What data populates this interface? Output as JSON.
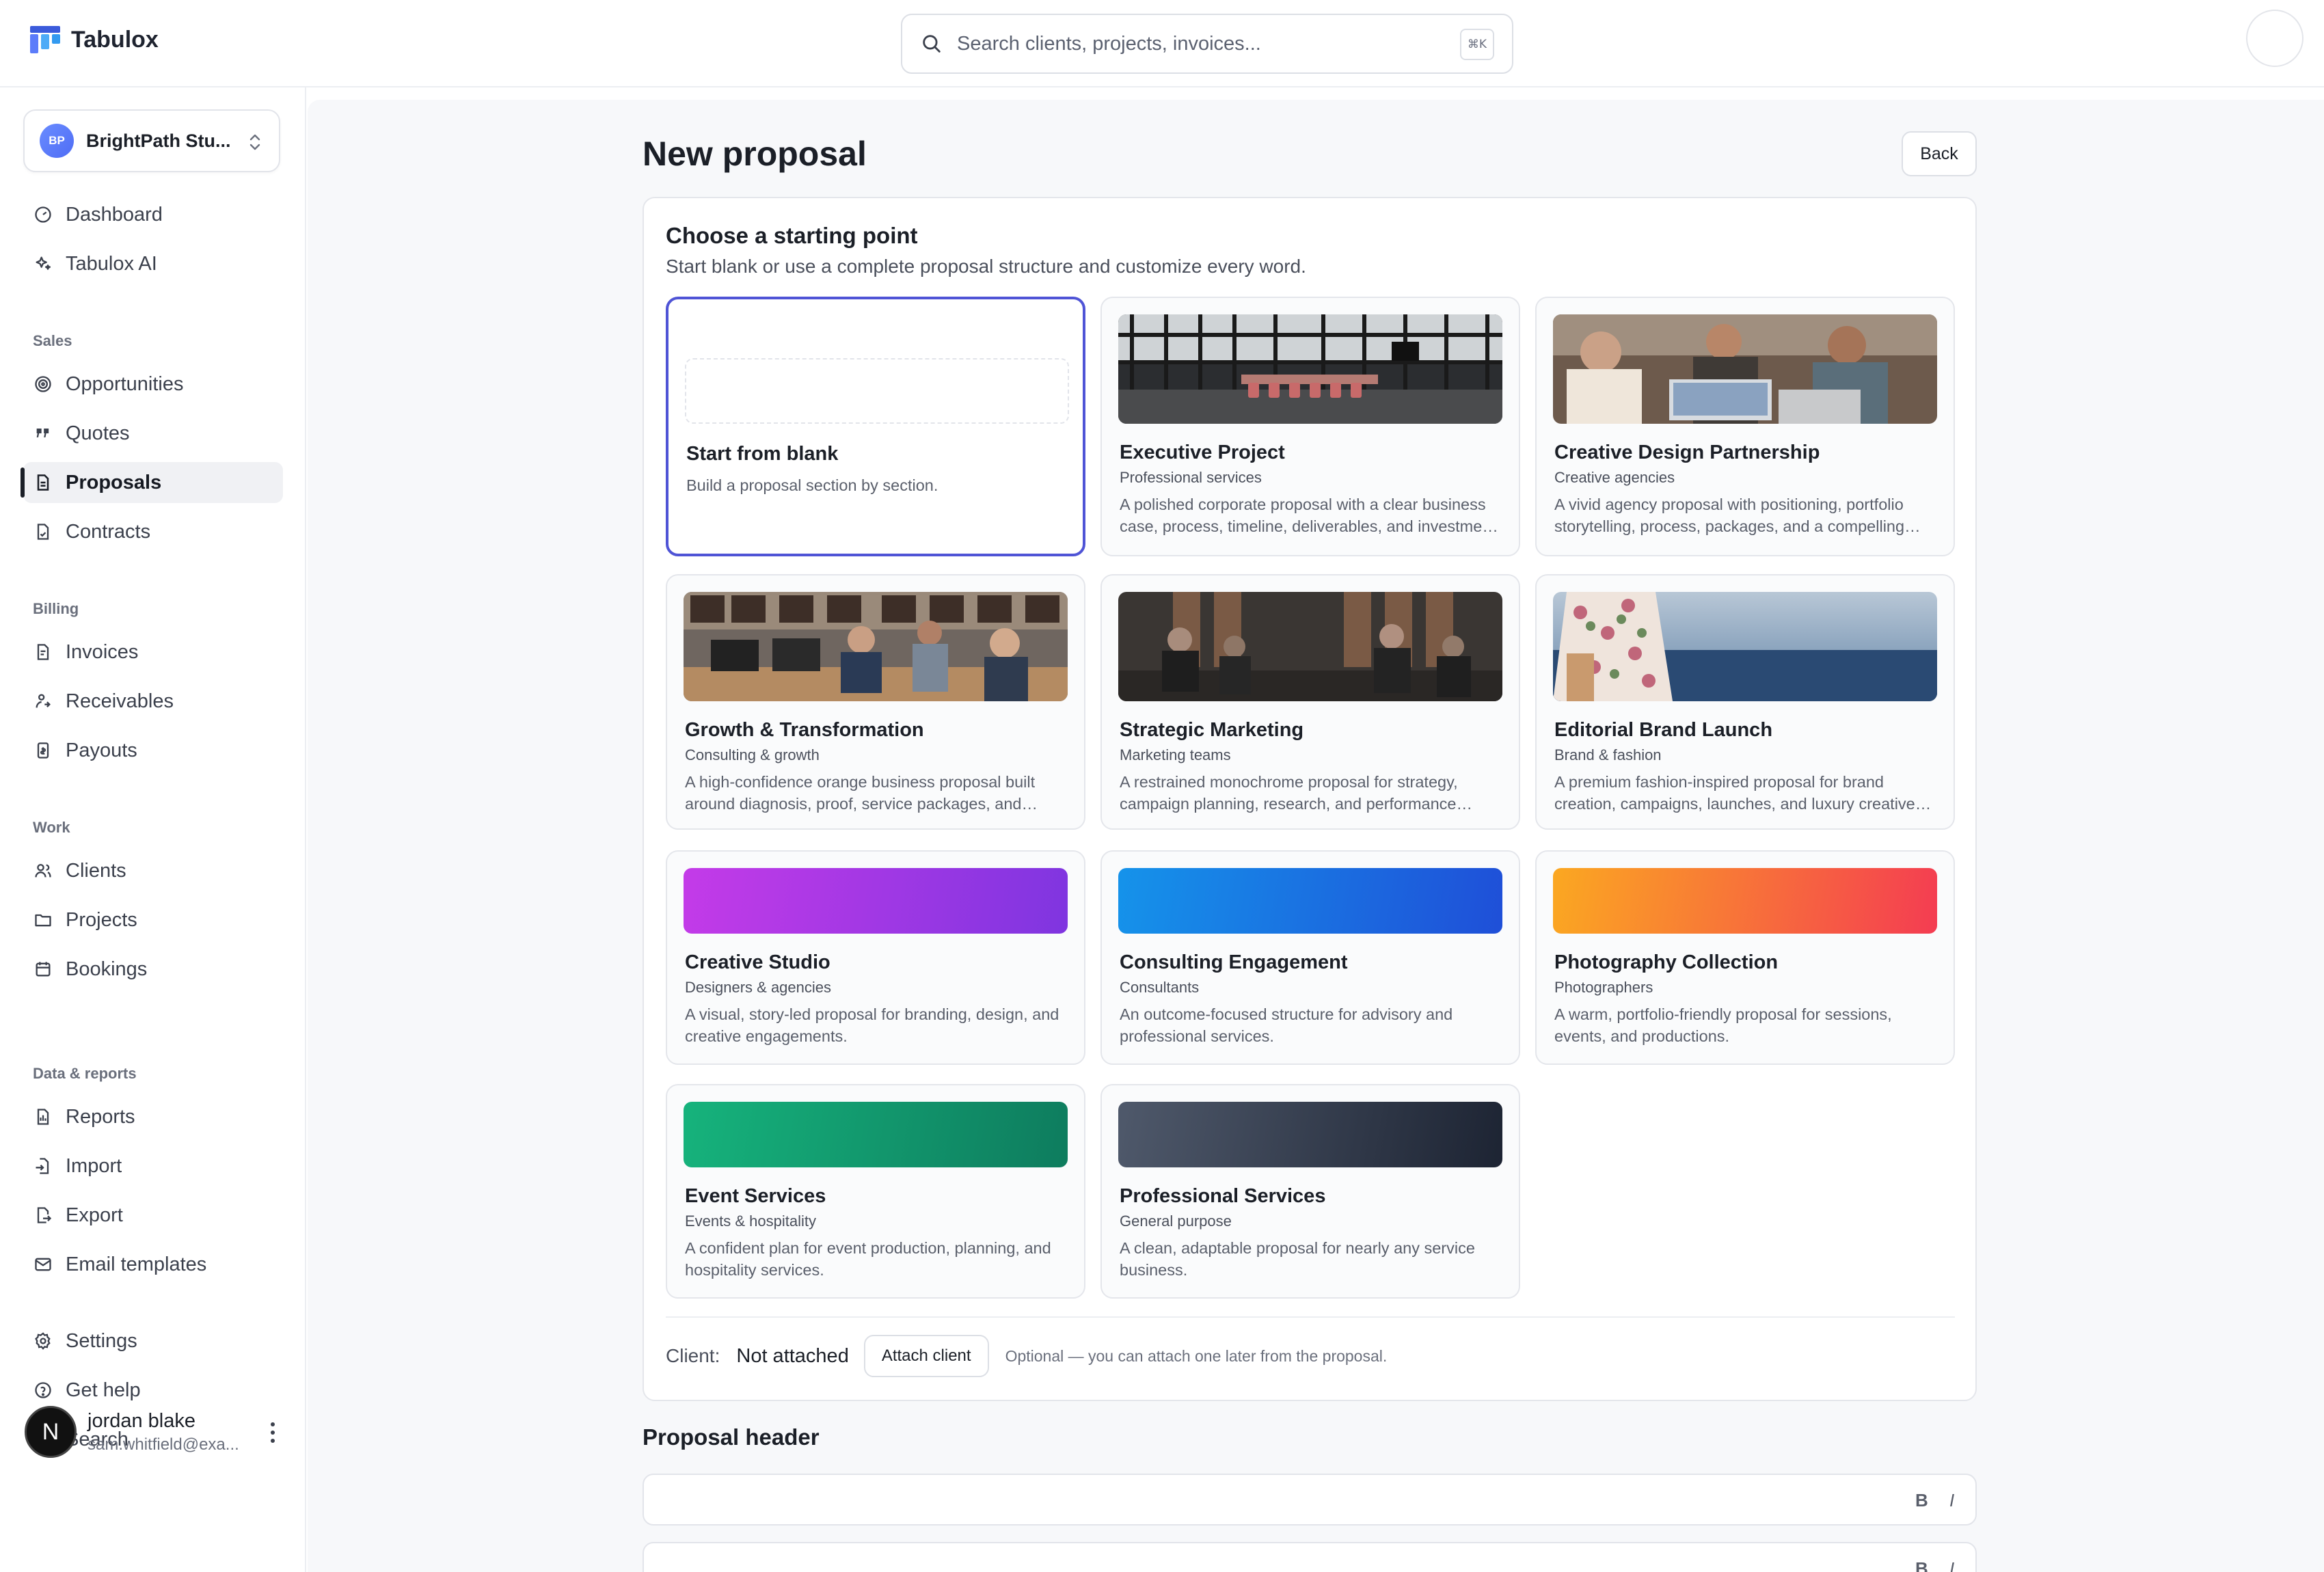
{
  "app": {
    "name": "Tabulox"
  },
  "search": {
    "placeholder": "Search clients, projects, invoices...",
    "shortcut": "⌘K"
  },
  "workspace": {
    "initials": "BP",
    "name": "BrightPath Stu..."
  },
  "sidebar": {
    "top_items": [
      {
        "label": "Dashboard",
        "icon": "gauge-icon"
      },
      {
        "label": "Tabulox AI",
        "icon": "sparkles-icon"
      }
    ],
    "sections": [
      {
        "title": "Sales",
        "items": [
          {
            "label": "Opportunities",
            "icon": "target-icon"
          },
          {
            "label": "Quotes",
            "icon": "quote-icon"
          },
          {
            "label": "Proposals",
            "icon": "document-icon",
            "active": true
          },
          {
            "label": "Contracts",
            "icon": "contract-icon"
          }
        ]
      },
      {
        "title": "Billing",
        "items": [
          {
            "label": "Invoices",
            "icon": "invoice-icon"
          },
          {
            "label": "Receivables",
            "icon": "receivables-icon"
          },
          {
            "label": "Payouts",
            "icon": "payouts-icon"
          }
        ]
      },
      {
        "title": "Work",
        "items": [
          {
            "label": "Clients",
            "icon": "users-icon"
          },
          {
            "label": "Projects",
            "icon": "folder-icon"
          },
          {
            "label": "Bookings",
            "icon": "calendar-icon"
          }
        ]
      },
      {
        "title": "Data & reports",
        "items": [
          {
            "label": "Reports",
            "icon": "reports-icon"
          },
          {
            "label": "Import",
            "icon": "import-icon"
          },
          {
            "label": "Export",
            "icon": "export-icon"
          },
          {
            "label": "Email templates",
            "icon": "mail-icon"
          }
        ]
      }
    ],
    "bottom_items": [
      {
        "label": "Settings",
        "icon": "gear-icon"
      },
      {
        "label": "Get help",
        "icon": "help-icon"
      },
      {
        "label": "Search",
        "icon": "search-icon"
      }
    ],
    "user": {
      "initial": "N",
      "name": "jordan blake",
      "email": "sam.whitfield@exa..."
    }
  },
  "page": {
    "title": "New proposal",
    "back_label": "Back",
    "chooser": {
      "title": "Choose a starting point",
      "subtitle": "Start blank or use a complete proposal structure and customize every word."
    },
    "templates": [
      {
        "name": "Start from blank",
        "category": "",
        "description": "Build a proposal section by section.",
        "kind": "blank",
        "selected": true
      },
      {
        "name": "Executive Project",
        "category": "Professional services",
        "description": "A polished corporate proposal with a clear business case, process, timeline, deliverables, and investment summary.",
        "kind": "photo",
        "scene": "office-interior"
      },
      {
        "name": "Creative Design Partnership",
        "category": "Creative agencies",
        "description": "A vivid agency proposal with positioning, portfolio storytelling, process, packages, and a compelling close.",
        "kind": "photo",
        "scene": "team-laptop"
      },
      {
        "name": "Growth & Transformation",
        "category": "Consulting & growth",
        "description": "A high-confidence orange business proposal built around diagnosis, proof, service packages, and outcomes.",
        "kind": "photo",
        "scene": "open-office"
      },
      {
        "name": "Strategic Marketing",
        "category": "Marketing teams",
        "description": "A restrained monochrome proposal for strategy, campaign planning, research, and performance reporting.",
        "kind": "photo",
        "scene": "meeting-mono"
      },
      {
        "name": "Editorial Brand Launch",
        "category": "Brand & fashion",
        "description": "A premium fashion-inspired proposal for brand creation, campaigns, launches, and luxury creative direction.",
        "kind": "photo",
        "scene": "fashion-sea"
      },
      {
        "name": "Creative Studio",
        "category": "Designers & agencies",
        "description": "A visual, story-led proposal for branding, design, and creative engagements.",
        "kind": "gradient",
        "colors": [
          "#c43be8",
          "#7f35e0"
        ]
      },
      {
        "name": "Consulting Engagement",
        "category": "Consultants",
        "description": "An outcome-focused structure for advisory and professional services.",
        "kind": "gradient",
        "colors": [
          "#1593ea",
          "#1f4fd8"
        ]
      },
      {
        "name": "Photography Collection",
        "category": "Photographers",
        "description": "A warm, portfolio-friendly proposal for sessions, events, and productions.",
        "kind": "gradient",
        "colors": [
          "#fba821",
          "#f43c52"
        ]
      },
      {
        "name": "Event Services",
        "category": "Events & hospitality",
        "description": "A confident plan for event production, planning, and hospitality services.",
        "kind": "gradient",
        "colors": [
          "#16b37c",
          "#0e7c5e"
        ]
      },
      {
        "name": "Professional Services",
        "category": "General purpose",
        "description": "A clean, adaptable proposal for nearly any service business.",
        "kind": "gradient",
        "colors": [
          "#4f596b",
          "#1d2433"
        ]
      }
    ],
    "client": {
      "label": "Client:",
      "value": "Not attached",
      "attach_label": "Attach client",
      "hint": "Optional — you can attach one later from the proposal."
    },
    "header_section": {
      "title": "Proposal header",
      "bold_label": "B",
      "italic_label": "I"
    }
  },
  "colors": {
    "accent": "#4f54d6",
    "text": "#1b1f27",
    "muted": "#5a5f6b",
    "border": "#e4e6eb",
    "canvas": "#f7f8fa"
  }
}
